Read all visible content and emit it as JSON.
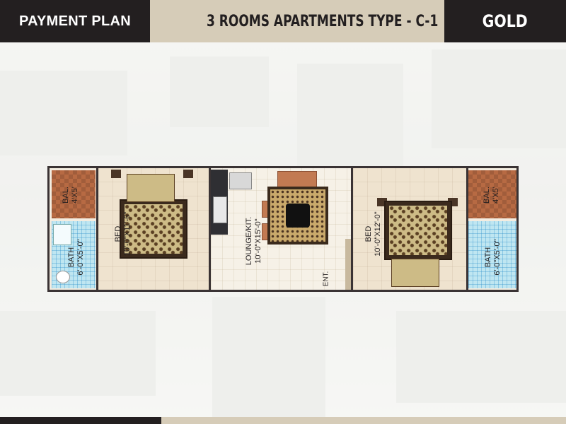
{
  "header": {
    "left_label": "PAYMENT PLAN",
    "title": "3 ROOMS APARTMENTS TYPE - C-1",
    "right_label": "GOLD"
  },
  "colors": {
    "dark": "#231f20",
    "tan": "#d6ccb8",
    "balcony": "#b76a43",
    "bath_tile": "#bfe6f1"
  },
  "plan": {
    "left_balcony": {
      "name": "BAL.",
      "size": "4'X5'"
    },
    "left_bath": {
      "name": "BATH",
      "size": "6'-0\"X5'-0\""
    },
    "bed_1": {
      "name": "BED",
      "size": "10'-0\"X11'-6\""
    },
    "lounge": {
      "name": "LOUNGE/KIT.",
      "size": "10'-0\"X15'-0\""
    },
    "entrance": "ENT.",
    "bed_2": {
      "name": "BED",
      "size": "10'-0\"X12'-0\""
    },
    "right_balcony": {
      "name": "BAL.",
      "size": "4'X5'"
    },
    "right_bath": {
      "name": "BATH",
      "size": "6'-0\"X5'-0\""
    }
  }
}
